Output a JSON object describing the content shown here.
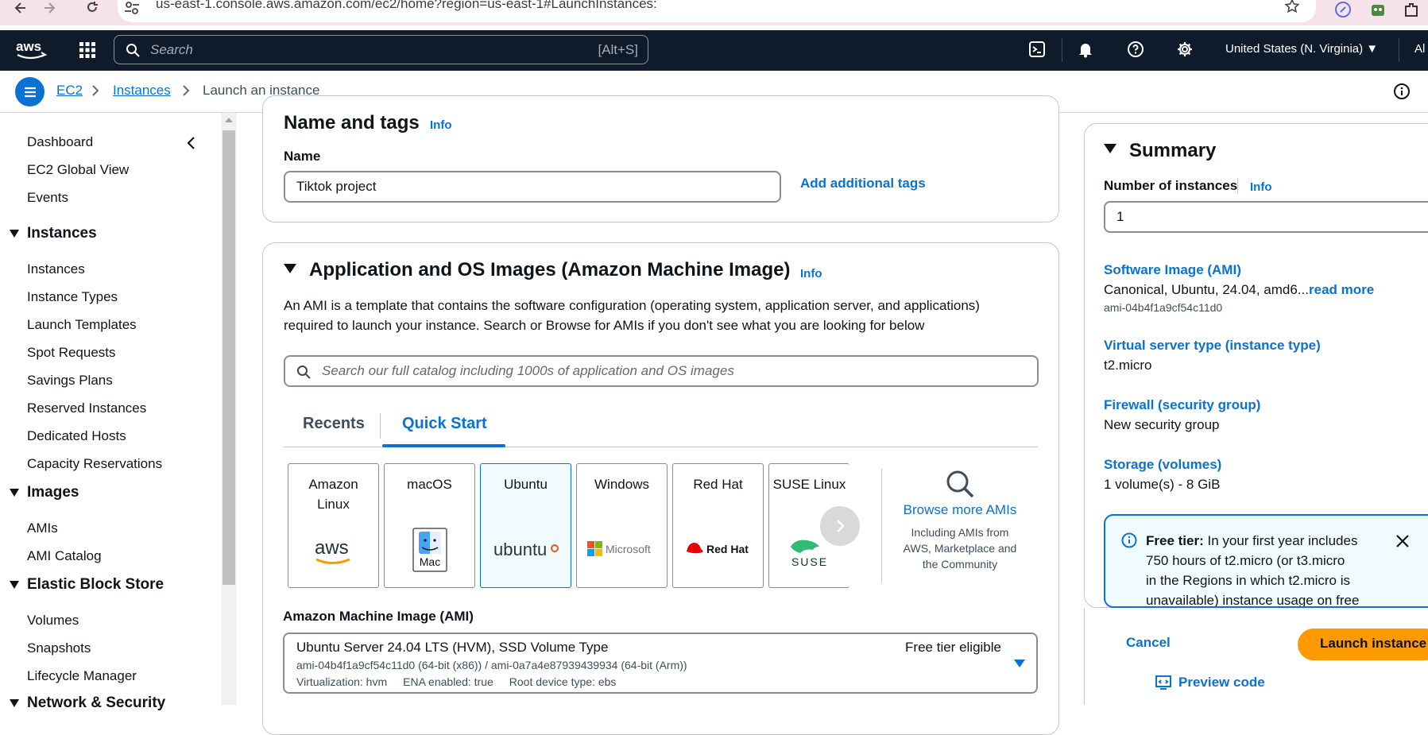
{
  "browser": {
    "url": "us-east-1.console.aws.amazon.com/ec2/home?region=us-east-1#LaunchInstances:"
  },
  "topbar": {
    "search_placeholder": "Search",
    "search_shortcut": "[Alt+S]",
    "region": "United States (N. Virginia) ▼",
    "account": "Al"
  },
  "breadcrumb": {
    "items": [
      "EC2",
      "Instances"
    ],
    "current": "Launch an instance"
  },
  "sidebar": {
    "top_items": [
      "Dashboard",
      "EC2 Global View",
      "Events"
    ],
    "instances_header": "Instances",
    "instances_items": [
      "Instances",
      "Instance Types",
      "Launch Templates",
      "Spot Requests",
      "Savings Plans",
      "Reserved Instances",
      "Dedicated Hosts",
      "Capacity Reservations"
    ],
    "images_header": "Images",
    "images_items": [
      "AMIs",
      "AMI Catalog"
    ],
    "ebs_header": "Elastic Block Store",
    "ebs_items": [
      "Volumes",
      "Snapshots",
      "Lifecycle Manager"
    ],
    "network_header": "Network & Security"
  },
  "name_tags": {
    "title": "Name and tags",
    "info": "Info",
    "name_label": "Name",
    "name_value": "Tiktok project",
    "add_tags": "Add additional tags"
  },
  "ami_section": {
    "title": "Application and OS Images (Amazon Machine Image)",
    "info": "Info",
    "description_1": "An AMI is a template that contains the software configuration (operating system, application server, and applications)",
    "description_2": "required to launch your instance. Search or Browse for AMIs if you don't see what you are looking for below",
    "search_placeholder": "Search our full catalog including 1000s of application and OS images",
    "tabs": [
      "Recents",
      "Quick Start"
    ],
    "os_cards": [
      {
        "name_1": "Amazon",
        "name_2": "Linux",
        "logo": "aws"
      },
      {
        "name_1": "macOS",
        "name_2": "",
        "logo": "Mac"
      },
      {
        "name_1": "Ubuntu",
        "name_2": "",
        "logo": "ubuntu"
      },
      {
        "name_1": "Windows",
        "name_2": "",
        "logo": "Microsoft"
      },
      {
        "name_1": "Red Hat",
        "name_2": "",
        "logo": "Red Hat"
      },
      {
        "name_1": "SUSE Linux",
        "name_2": "",
        "logo": "SUSE"
      }
    ],
    "browse_more": "Browse more AMIs",
    "browse_desc_1": "Including AMIs from",
    "browse_desc_2": "AWS, Marketplace and",
    "browse_desc_3": "the Community",
    "ami_label": "Amazon Machine Image (AMI)",
    "ami_name": "Ubuntu Server 24.04 LTS (HVM), SSD Volume Type",
    "ami_ids": "ami-04b4f1a9cf54c11d0 (64-bit (x86)) / ami-0a7a4e87939439934 (64-bit (Arm))",
    "ami_virtualization": "Virtualization: hvm",
    "ami_ena": "ENA enabled: true",
    "ami_root": "Root device type: ebs",
    "free_tier_eligible": "Free tier eligible"
  },
  "summary": {
    "title": "Summary",
    "instances_label": "Number of instances",
    "info": "Info",
    "instances_value": "1",
    "software_label": "Software Image (AMI)",
    "software_value": "Canonical, Ubuntu, 24.04, amd6...",
    "read_more": "read more",
    "software_id": "ami-04b4f1a9cf54c11d0",
    "server_label": "Virtual server type (instance type)",
    "server_value": "t2.micro",
    "firewall_label": "Firewall (security group)",
    "firewall_value": "New security group",
    "storage_label": "Storage (volumes)",
    "storage_value": "1 volume(s) - 8 GiB",
    "free_tier_bold": "Free tier:",
    "free_tier_l1": "In your first year includes",
    "free_tier_l2": "750 hours of t2.micro (or t3.micro",
    "free_tier_l3": "in the Regions in which t2.micro is",
    "free_tier_l4": "unavailable) instance usage on free",
    "cancel": "Cancel",
    "launch": "Launch instance",
    "preview_code": "Preview code"
  },
  "colors": {
    "aws_dark": "#0f1b2a",
    "link_blue": "#0972d3",
    "launch_orange": "#ff9900"
  }
}
